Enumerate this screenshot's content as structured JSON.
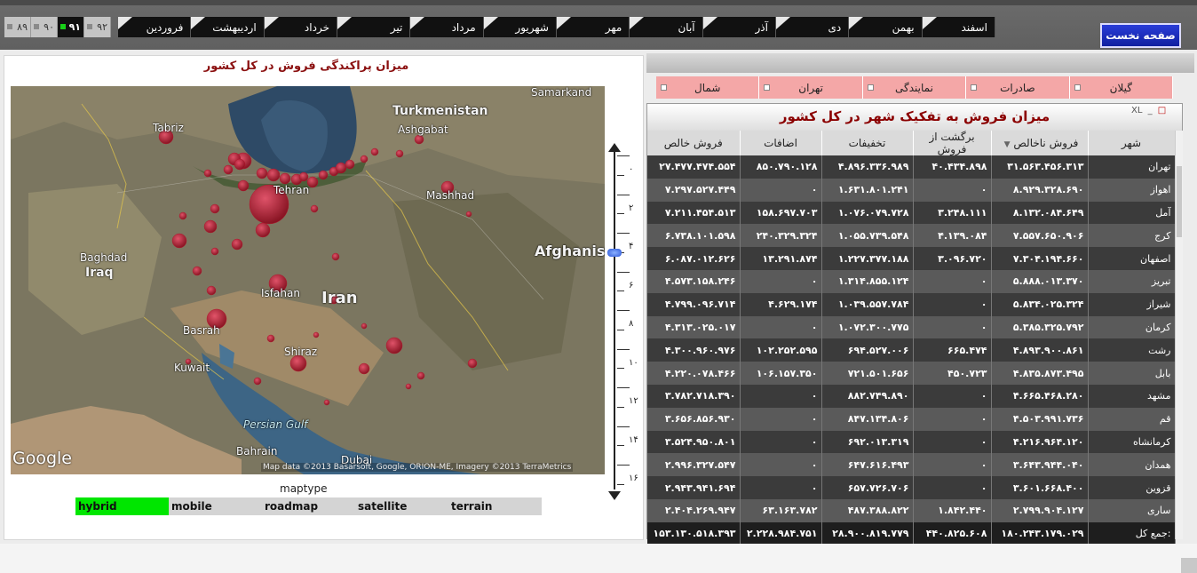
{
  "toolbar": {
    "years": [
      {
        "label": "۸۹",
        "active": false
      },
      {
        "label": "۹۰",
        "active": false
      },
      {
        "label": "۹۱",
        "active": true
      },
      {
        "label": "۹۲",
        "active": false
      }
    ],
    "months": [
      "فروردین",
      "اردیبهشت",
      "خرداد",
      "تیر",
      "مرداد",
      "شهریور",
      "مهر",
      "آبان",
      "آذر",
      "دی",
      "بهمن",
      "اسفند"
    ],
    "home_label": "صفحه نخست"
  },
  "map": {
    "title": "میزان پراکندگی فروش در کل کشور",
    "labels": [
      "Samarkand",
      "Turkmenistan",
      "Ashgabat",
      "Tabriz",
      "Tehran",
      "Mashhad",
      "Baghdad",
      "Iraq",
      "Afghanistan",
      "Isfahan",
      "Iran",
      "Basrah",
      "Shiraz",
      "Kuwait",
      "Persian Gulf",
      "Bahrain",
      "Dubai"
    ],
    "logo": "Google",
    "attribution": "Map data ©2013 Basarsoft, Google, ORION-ME, Imagery ©2013 TerraMetrics",
    "zoom_labels": [
      "۰",
      "۲",
      "۴",
      "۶",
      "۸",
      "۱۰",
      "۱۲",
      "۱۴",
      "۱۶"
    ],
    "zoom_level": 5,
    "maptype_label": "maptype",
    "maptypes": [
      {
        "label": "hybrid",
        "active": true
      },
      {
        "label": "mobile",
        "active": false
      },
      {
        "label": "roadmap",
        "active": false
      },
      {
        "label": "satellite",
        "active": false
      },
      {
        "label": "terrain",
        "active": false
      }
    ],
    "bubble_color": "#b3142a"
  },
  "filters": [
    "گیلان",
    "صادرات",
    "نمایندگی",
    "تهران",
    "شمال"
  ],
  "table": {
    "title": "میزان فروش به تفکیک شهر در کل کشور",
    "window_controls": [
      "XL",
      "_",
      "□"
    ],
    "columns": [
      "فروش خالص",
      "اضافات",
      "تخفیفات",
      "برگشت از فروش",
      "فروش ناخالص",
      "شهر"
    ],
    "rows": [
      [
        "۲۷.۴۷۷.۴۷۴.۵۵۴",
        "۸۵۰.۷۹۰.۱۲۸",
        "۴.۸۹۶.۳۳۶.۹۸۹",
        "۴۰.۴۳۴.۸۹۸",
        "۳۱.۵۶۳.۴۵۶.۳۱۳",
        "تهران"
      ],
      [
        "۷.۲۹۷.۵۲۷.۴۴۹",
        "۰",
        "۱.۶۳۱.۸۰۱.۲۴۱",
        "۰",
        "۸.۹۲۹.۳۲۸.۶۹۰",
        "اهواز"
      ],
      [
        "۷.۲۱۱.۴۵۴.۵۱۳",
        "۱۵۸.۶۹۷.۷۰۳",
        "۱.۰۷۶.۰۷۹.۷۲۸",
        "۳.۲۴۸.۱۱۱",
        "۸.۱۳۲.۰۸۴.۶۴۹",
        "آمل"
      ],
      [
        "۶.۷۳۸.۱۰۱.۵۹۸",
        "۲۴۰.۳۲۹.۳۲۴",
        "۱.۰۵۵.۷۳۹.۵۴۸",
        "۴.۱۳۹.۰۸۴",
        "۷.۵۵۷.۶۵۰.۹۰۶",
        "کرج"
      ],
      [
        "۶.۰۸۷.۰۱۲.۶۲۶",
        "۱۳.۲۹۱.۸۷۴",
        "۱.۲۲۷.۳۷۷.۱۸۸",
        "۳.۰۹۶.۷۲۰",
        "۷.۳۰۴.۱۹۴.۶۶۰",
        "اصفهان"
      ],
      [
        "۴.۵۷۳.۱۵۸.۲۴۶",
        "۰",
        "۱.۳۱۴.۸۵۵.۱۲۴",
        "۰",
        "۵.۸۸۸.۰۱۳.۳۷۰",
        "تبریز"
      ],
      [
        "۴.۷۹۹.۰۹۶.۷۱۴",
        "۴.۶۲۹.۱۷۴",
        "۱.۰۳۹.۵۵۷.۷۸۴",
        "۰",
        "۵.۸۳۴.۰۲۵.۳۲۴",
        "شیراز"
      ],
      [
        "۴.۳۱۳.۰۲۵.۰۱۷",
        "۰",
        "۱.۰۷۲.۳۰۰.۷۷۵",
        "۰",
        "۵.۳۸۵.۳۲۵.۷۹۲",
        "کرمان"
      ],
      [
        "۴.۳۰۰.۹۶۰.۹۷۶",
        "۱۰۲.۲۵۲.۵۹۵",
        "۶۹۴.۵۲۷.۰۰۶",
        "۶۶۵.۴۷۴",
        "۴.۸۹۳.۹۰۰.۸۶۱",
        "رشت"
      ],
      [
        "۴.۲۲۰.۰۷۸.۴۶۶",
        "۱۰۶.۱۵۷.۳۵۰",
        "۷۲۱.۵۰۱.۶۵۶",
        "۴۵۰.۷۲۳",
        "۴.۸۳۵.۸۷۳.۴۹۵",
        "بابل"
      ],
      [
        "۳.۷۸۲.۷۱۸.۳۹۰",
        "۰",
        "۸۸۲.۷۴۹.۸۹۰",
        "۰",
        "۴.۶۶۵.۴۶۸.۲۸۰",
        "مشهد"
      ],
      [
        "۳.۶۵۶.۸۵۶.۹۳۰",
        "۰",
        "۸۴۷.۱۳۴.۸۰۶",
        "۰",
        "۴.۵۰۳.۹۹۱.۷۳۶",
        "قم"
      ],
      [
        "۳.۵۲۴.۹۵۰.۸۰۱",
        "۰",
        "۶۹۲.۰۱۳.۳۱۹",
        "۰",
        "۴.۲۱۶.۹۶۴.۱۲۰",
        "کرمانشاه"
      ],
      [
        "۲.۹۹۶.۳۲۷.۵۴۷",
        "۰",
        "۶۴۷.۶۱۶.۴۹۳",
        "۰",
        "۳.۶۴۳.۹۴۴.۰۴۰",
        "همدان"
      ],
      [
        "۲.۹۴۳.۹۴۱.۶۹۴",
        "۰",
        "۶۵۷.۷۲۶.۷۰۶",
        "۰",
        "۳.۶۰۱.۶۶۸.۴۰۰",
        "قزوین"
      ],
      [
        "۲.۴۰۴.۲۶۹.۹۴۷",
        "۶۳.۱۶۳.۷۸۲",
        "۴۸۷.۳۸۸.۸۲۲",
        "۱.۸۴۲.۴۴۰",
        "۲.۷۹۹.۹۰۴.۱۲۷",
        "ساری"
      ]
    ],
    "total_label": "جمع کل:",
    "totals": [
      "۱۵۳.۱۳۰.۵۱۸.۳۹۳",
      "۲.۲۲۸.۹۸۴.۷۵۱",
      "۲۸.۹۰۰.۸۱۹.۷۷۹",
      "۴۴۰.۸۲۵.۶۰۸",
      "۱۸۰.۲۴۳.۱۷۹.۰۲۹"
    ]
  }
}
